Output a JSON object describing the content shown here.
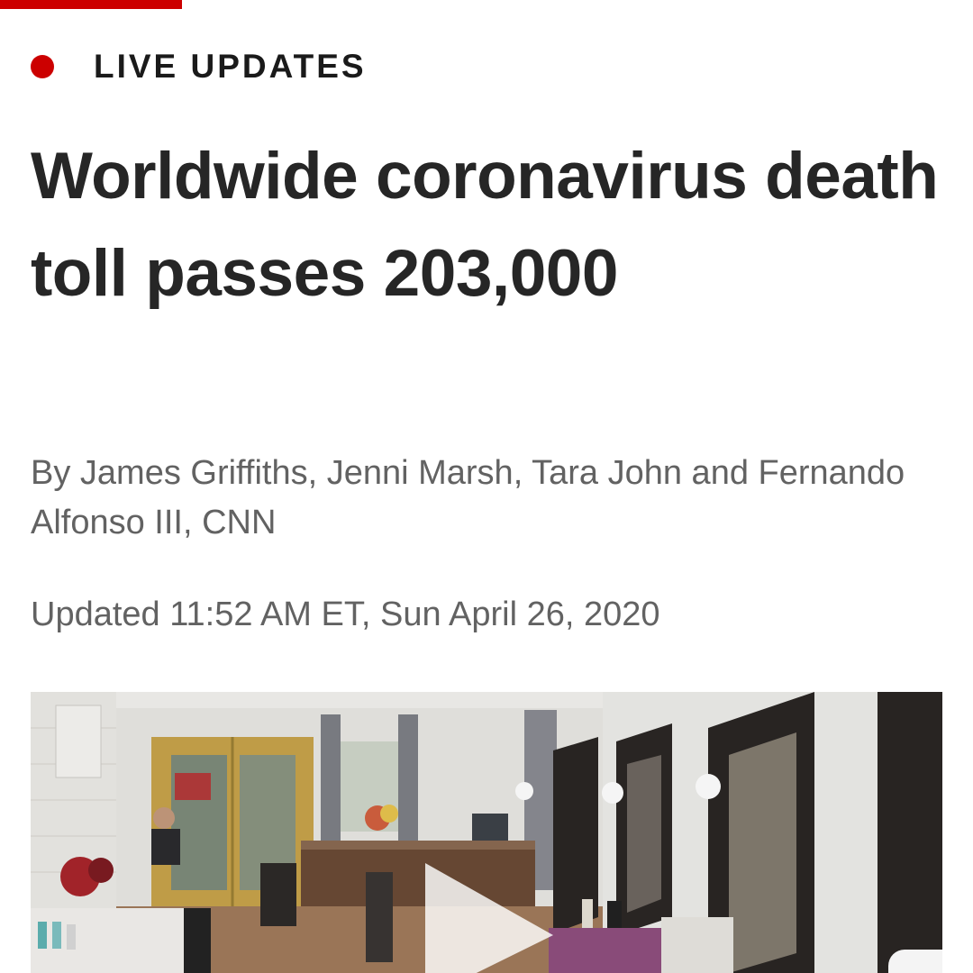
{
  "section": {
    "live_label": "LIVE UPDATES"
  },
  "article": {
    "headline": "Worldwide coronavirus death toll passes 203,000",
    "byline": "By James Griffiths, Jenni Marsh, Tara John and Fernando Alfonso III, CNN",
    "updated": "Updated 11:52 AM ET, Sun April 26, 2020"
  },
  "video": {
    "thumbnail_icon": "salon-interior-photo",
    "play_icon": "play-icon"
  },
  "colors": {
    "accent": "#cc0000",
    "headline": "#262626",
    "meta": "#626262"
  }
}
